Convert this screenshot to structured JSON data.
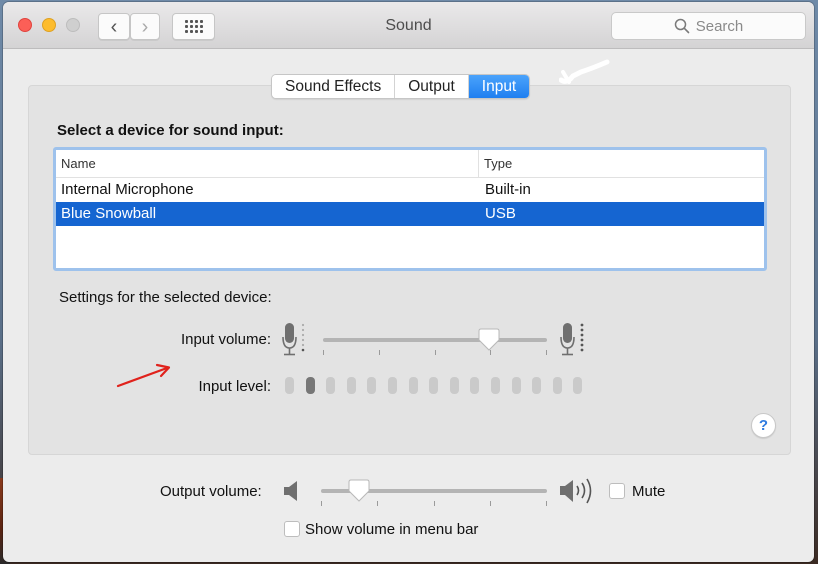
{
  "window": {
    "title": "Sound",
    "search_placeholder": "Search"
  },
  "toolbar": {
    "back_icon": "chevron-left-icon",
    "forward_icon": "chevron-right-icon",
    "show_all_icon": "grid-icon",
    "back_glyph": "‹",
    "forward_glyph": "›"
  },
  "tabs": [
    {
      "label": "Sound Effects",
      "active": false
    },
    {
      "label": "Output",
      "active": false
    },
    {
      "label": "Input",
      "active": true
    }
  ],
  "input_pane": {
    "device_section_title": "Select a device for sound input:",
    "columns": {
      "name": "Name",
      "type": "Type"
    },
    "devices": [
      {
        "name": "Internal Microphone",
        "type": "Built-in",
        "selected": false
      },
      {
        "name": "Blue Snowball",
        "type": "USB",
        "selected": true
      }
    ],
    "settings_title": "Settings for the selected device:",
    "input_volume_label": "Input volume:",
    "input_volume_value": 0.74,
    "input_level_label": "Input level:",
    "input_level_segments": 15,
    "input_level_active": 2,
    "help_label": "?"
  },
  "output": {
    "output_volume_label": "Output volume:",
    "output_volume_value": 0.17,
    "mute_label": "Mute",
    "mute_checked": false,
    "show_volume_label": "Show volume in menu bar",
    "show_volume_checked": false
  },
  "colors": {
    "accent": "#1f7ff0",
    "selection": "#1565d1",
    "annotation_arrow": "#e0221c"
  }
}
